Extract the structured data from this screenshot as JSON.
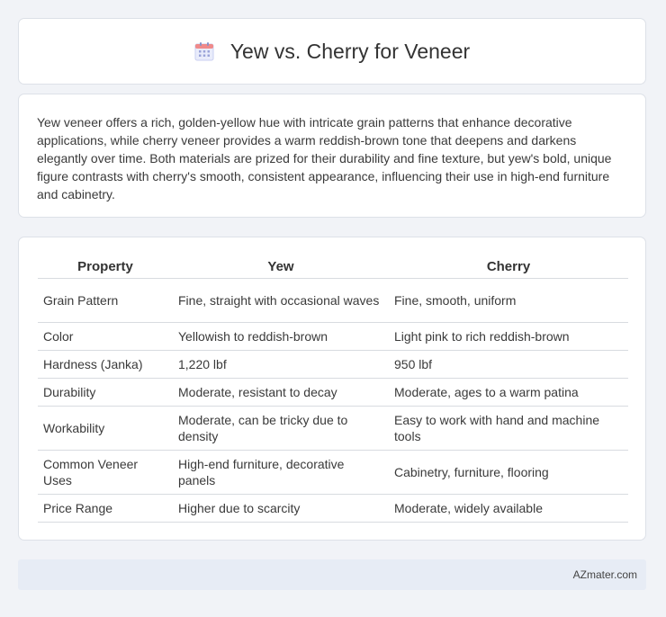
{
  "header": {
    "title": "Yew vs. Cherry for Veneer",
    "icon": "calendar-icon"
  },
  "intro": {
    "text": "Yew veneer offers a rich, golden-yellow hue with intricate grain patterns that enhance decorative applications, while cherry veneer provides a warm reddish-brown tone that deepens and darkens elegantly over time. Both materials are prized for their durability and fine texture, but yew's bold, unique figure contrasts with cherry's smooth, consistent appearance, influencing their use in high-end furniture and cabinetry."
  },
  "table": {
    "headers": [
      "Property",
      "Yew",
      "Cherry"
    ],
    "rows": [
      [
        "Grain Pattern",
        "Fine, straight with occasional waves",
        "Fine, smooth, uniform"
      ],
      [
        "Color",
        "Yellowish to reddish-brown",
        "Light pink to rich reddish-brown"
      ],
      [
        "Hardness (Janka)",
        "1,220 lbf",
        "950 lbf"
      ],
      [
        "Durability",
        "Moderate, resistant to decay",
        "Moderate, ages to a warm patina"
      ],
      [
        "Workability",
        "Moderate, can be tricky due to density",
        "Easy to work with hand and machine tools"
      ],
      [
        "Common Veneer Uses",
        "High-end furniture, decorative panels",
        "Cabinetry, furniture, flooring"
      ],
      [
        "Price Range",
        "Higher due to scarcity",
        "Moderate, widely available"
      ]
    ]
  },
  "footer": {
    "text": "AZmater.com"
  }
}
